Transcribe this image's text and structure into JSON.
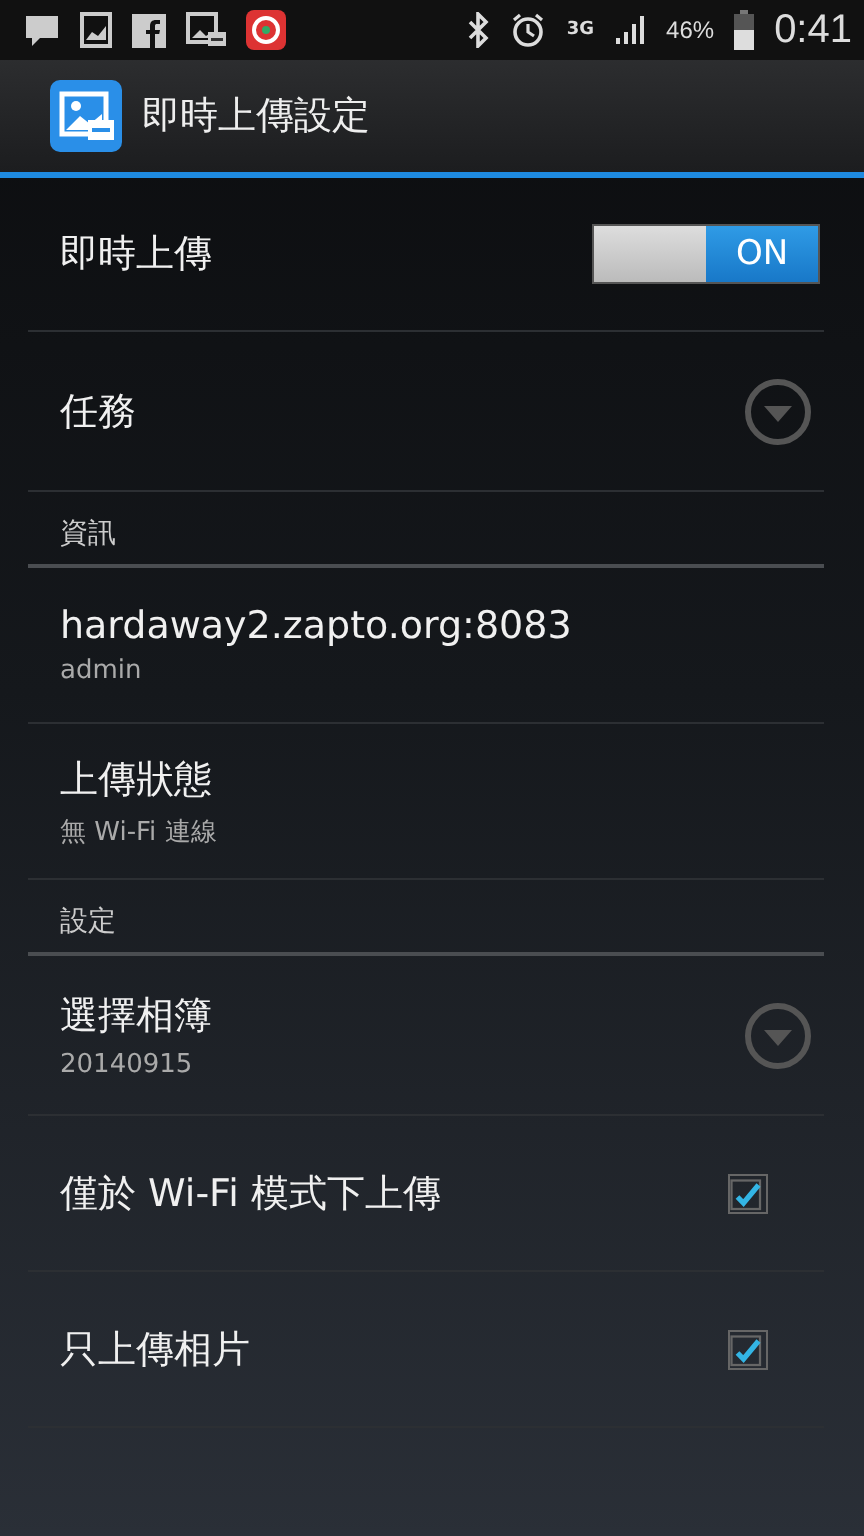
{
  "status_bar": {
    "network": "3G",
    "battery": "46%",
    "time": "0:41"
  },
  "action_bar": {
    "title": "即時上傳設定"
  },
  "items": [
    {
      "kind": "switch",
      "title": "即時上傳",
      "toggle_label": "ON",
      "on": true
    },
    {
      "kind": "dropdown",
      "title": "任務"
    },
    {
      "kind": "section",
      "title": "資訊"
    },
    {
      "kind": "text",
      "title": "hardaway2.zapto.org:8083",
      "summary": "admin"
    },
    {
      "kind": "text",
      "title": "上傳狀態",
      "summary": "無 Wi-Fi 連線"
    },
    {
      "kind": "section",
      "title": "設定"
    },
    {
      "kind": "dropdown",
      "title": "選擇相簿",
      "summary": "20140915"
    },
    {
      "kind": "checkbox",
      "title": "僅於 Wi-Fi 模式下上傳",
      "checked": true
    },
    {
      "kind": "checkbox",
      "title": "只上傳相片",
      "checked": true
    }
  ]
}
